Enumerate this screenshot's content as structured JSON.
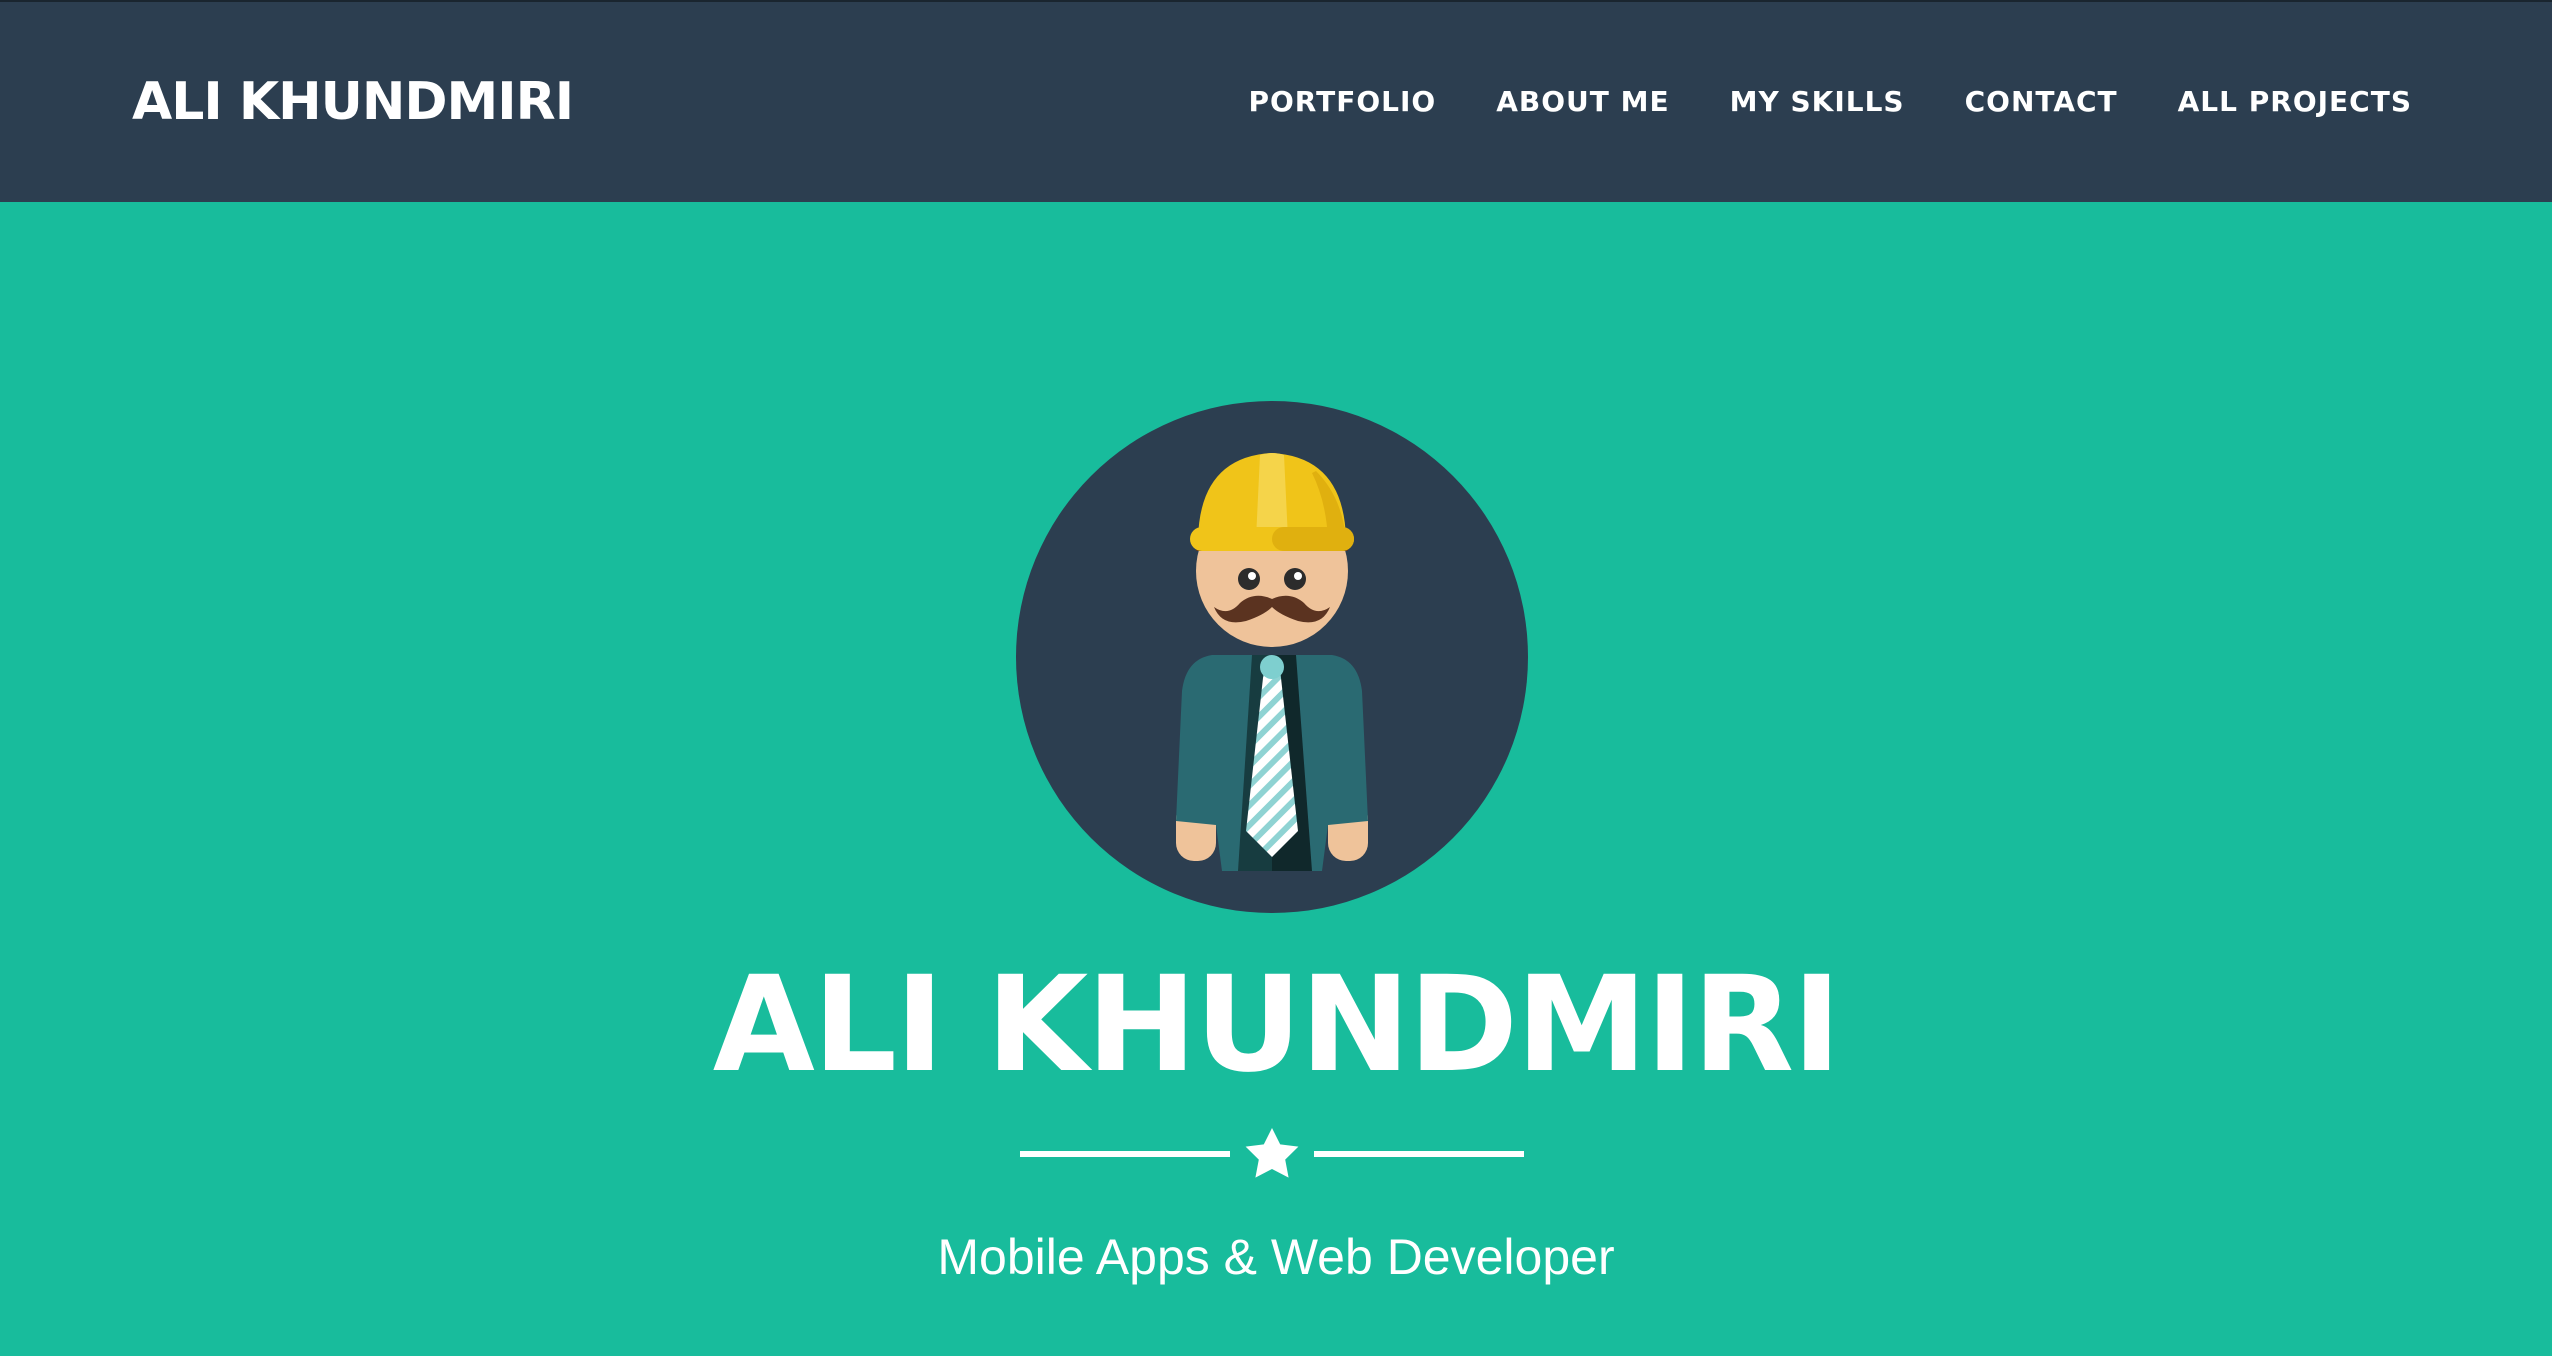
{
  "header": {
    "brand": "ALI KHUNDMIRI",
    "nav": [
      {
        "label": "PORTFOLIO"
      },
      {
        "label": "ABOUT ME"
      },
      {
        "label": "MY SKILLS"
      },
      {
        "label": "CONTACT"
      },
      {
        "label": "ALL PROJECTS"
      }
    ]
  },
  "hero": {
    "avatar_icon": "engineer-avatar-icon",
    "title": "ALI KHUNDMIRI",
    "divider_icon": "star-icon",
    "subtitle": "Mobile Apps & Web Developer"
  },
  "colors": {
    "navbar": "#2c3e50",
    "hero": "#18bc9c",
    "text": "#ffffff"
  }
}
